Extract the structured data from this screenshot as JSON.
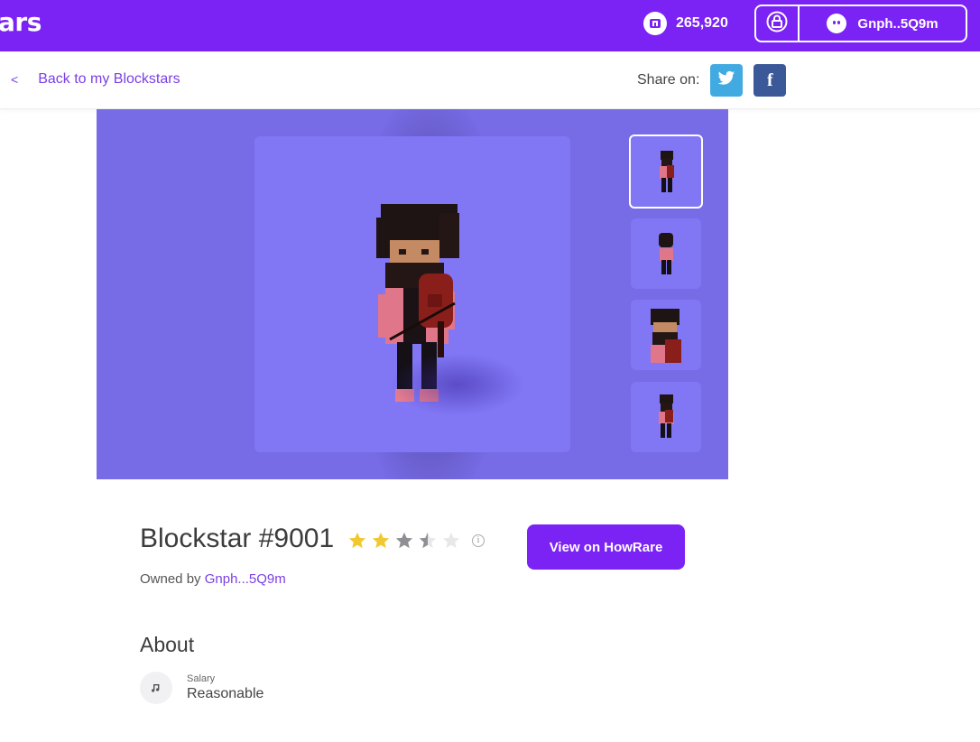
{
  "header": {
    "brand": "ars",
    "balance": "265,920",
    "wallet_address": "Gnph..5Q9m",
    "accent": "#7b22f5"
  },
  "subnav": {
    "back_chevron": "<",
    "back_label": "Back to my Blockstars",
    "share_label": "Share on:",
    "twitter_icon": "twitter-icon",
    "facebook_glyph": "f"
  },
  "gallery": {
    "thumbnail_count": 4,
    "selected_index": 0
  },
  "item": {
    "name": "Blockstar #9001",
    "rating": 3.5,
    "rating_max": 5,
    "info_glyph": "i",
    "owned_prefix": "Owned by",
    "owner": "Gnph...5Q9m",
    "cta_label": "View on HowRare"
  },
  "about": {
    "heading": "About",
    "attributes": [
      {
        "label": "Salary",
        "value": "Reasonable",
        "icon": "music-note-icon"
      }
    ]
  }
}
